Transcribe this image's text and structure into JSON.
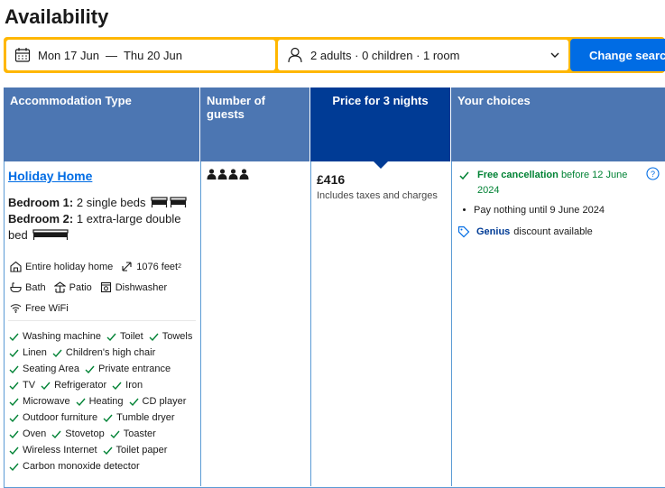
{
  "heading": "Availability",
  "search": {
    "checkin": "Mon 17 Jun",
    "separator": "—",
    "checkout": "Thu 20 Jun",
    "guests": "2 adults · 0 children · 1 room",
    "button": "Change search"
  },
  "table": {
    "headers": [
      "Accommodation Type",
      "Number of guests",
      "Price for 3 nights",
      "Your choices"
    ],
    "unit": {
      "name": "Holiday Home",
      "bedroom1_label": "Bedroom 1:",
      "bedroom1_value": "2 single beds",
      "bedroom2_label": "Bedroom 2:",
      "bedroom2_value": "1 extra-large double bed",
      "facilities": {
        "entire_home": "Entire holiday home",
        "size": "1076 feet",
        "size_sup": "2",
        "bath": "Bath",
        "patio": "Patio",
        "dishwasher": "Dishwasher",
        "wifi": "Free WiFi"
      },
      "amenity_rows": [
        [
          "Washing machine",
          "Toilet",
          "Towels"
        ],
        [
          "Linen",
          "Children's high chair"
        ],
        [
          "Seating Area",
          "Private entrance"
        ],
        [
          "TV",
          "Refrigerator",
          "Iron"
        ],
        [
          "Microwave",
          "Heating",
          "CD player"
        ],
        [
          "Outdoor furniture",
          "Tumble dryer"
        ],
        [
          "Oven",
          "Stovetop",
          "Toaster"
        ],
        [
          "Wireless Internet",
          "Toilet paper"
        ],
        [
          "Carbon monoxide detector"
        ]
      ]
    },
    "guest_count": 4,
    "price": "£416",
    "price_note": "Includes taxes and charges",
    "choices": {
      "free_cancel": "Free cancellation",
      "cancel_date": "before 12 June 2024",
      "pay_nothing": "Pay nothing until 9 June 2024",
      "genius": "Genius",
      "genius_text": "discount available"
    }
  },
  "colors": {
    "header_bg": "#4c76b2",
    "header_selected": "#003b95",
    "brand_yellow": "#ffb700",
    "button_blue": "#006ce4",
    "green": "#008234"
  }
}
